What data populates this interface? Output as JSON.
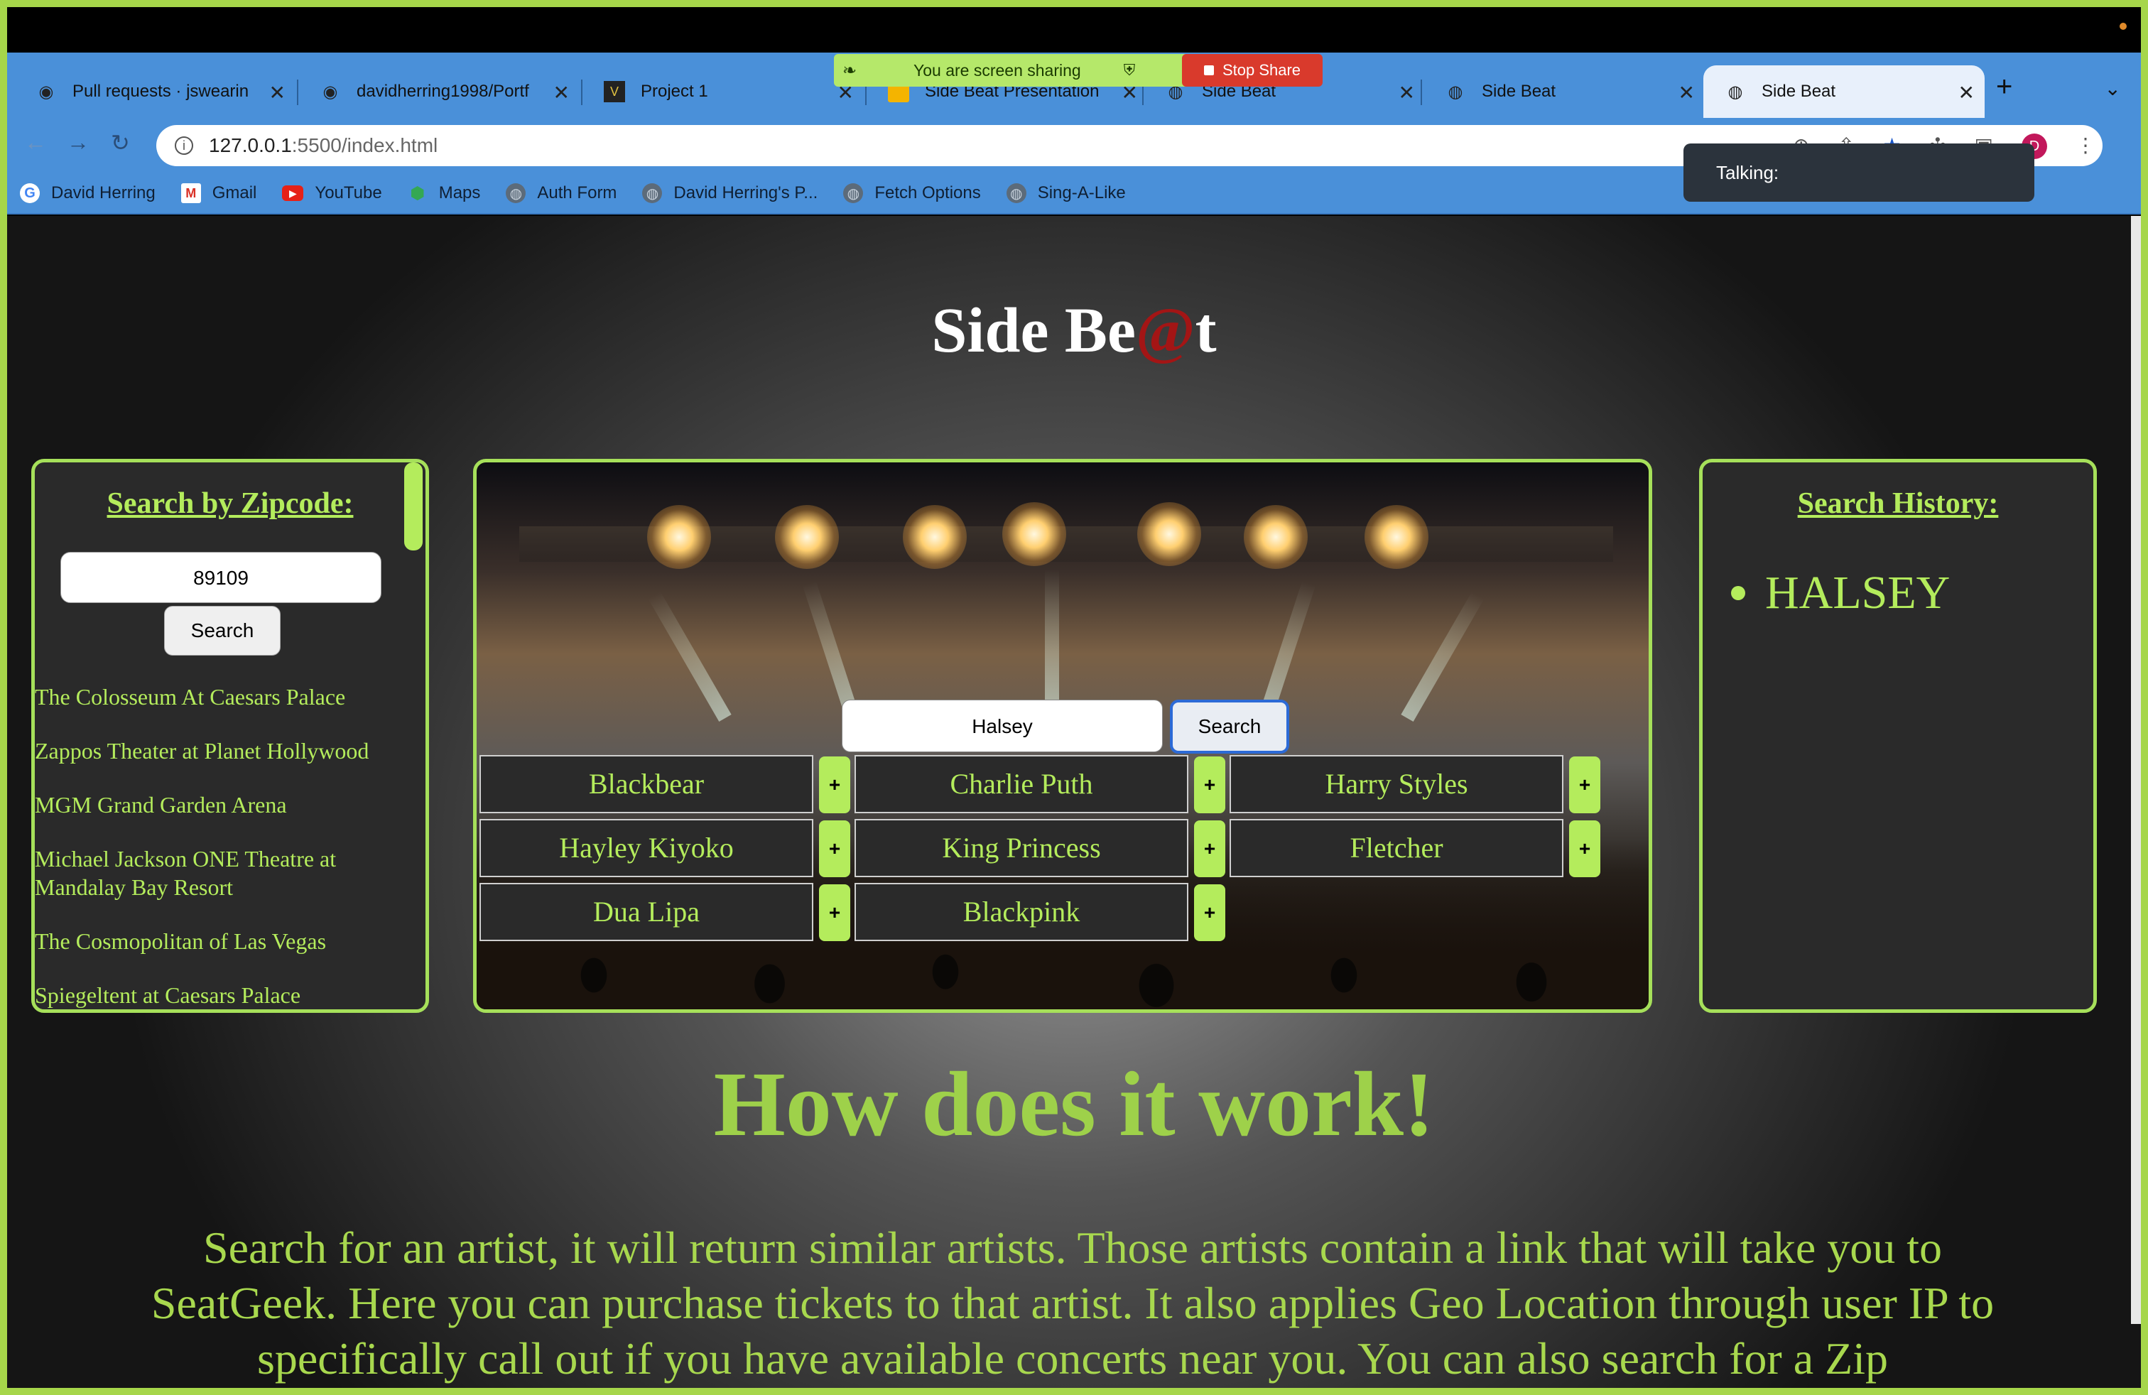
{
  "browser": {
    "tabs": [
      {
        "title": "Pull requests · jswearin",
        "icon": "github-icon"
      },
      {
        "title": "davidherring1998/Portf",
        "icon": "github-icon"
      },
      {
        "title": "Project 1",
        "icon": "project-icon"
      },
      {
        "title": "Side Beat Presentation",
        "icon": "slides-icon"
      },
      {
        "title": "Side Beat",
        "icon": "globe-icon"
      },
      {
        "title": "Side Beat",
        "icon": "globe-icon"
      },
      {
        "title": "Side Beat",
        "icon": "globe-icon",
        "active": true
      }
    ],
    "url_host": "127.0.0.1",
    "url_path": ":5500/index.html",
    "avatar_letter": "D",
    "bookmarks": [
      {
        "label": "David Herring",
        "icon": "google-icon"
      },
      {
        "label": "Gmail",
        "icon": "gmail-icon"
      },
      {
        "label": "YouTube",
        "icon": "youtube-icon"
      },
      {
        "label": "Maps",
        "icon": "maps-icon"
      },
      {
        "label": "Auth Form",
        "icon": "globe-icon"
      },
      {
        "label": "David Herring's P...",
        "icon": "globe-icon"
      },
      {
        "label": "Fetch Options",
        "icon": "globe-icon"
      },
      {
        "label": "Sing-A-Like",
        "icon": "globe-icon"
      }
    ]
  },
  "screen_share": {
    "status": "You are screen sharing",
    "stop_label": "Stop Share"
  },
  "talking_label": "Talking:",
  "site": {
    "title_prefix": "Side Be",
    "title_at": "@",
    "title_suffix": "t"
  },
  "zip_panel": {
    "heading": "Search by Zipcode:",
    "zip_value": "89109",
    "search_label": "Search",
    "venues": [
      "The Colosseum At Caesars Palace",
      "Zappos Theater at Planet Hollywood",
      "MGM Grand Garden Arena",
      "Michael Jackson ONE Theatre at Mandalay Bay Resort",
      "The Cosmopolitan of Las Vegas",
      "Spiegeltent at Caesars Palace"
    ]
  },
  "artist_search": {
    "value": "Halsey",
    "search_label": "Search",
    "add_label": "+",
    "artists": [
      "Blackbear",
      "Charlie Puth",
      "Harry Styles",
      "Hayley Kiyoko",
      "King Princess",
      "Fletcher",
      "Dua Lipa",
      "Blackpink"
    ]
  },
  "history_panel": {
    "heading": "Search History:",
    "items": [
      "HALSEY"
    ]
  },
  "how": {
    "title": "How does it work!",
    "body": "Search for an artist, it will return similar artists. Those artists contain a link that will take you to SeatGeek. Here you can purchase tickets to that artist. It also applies Geo Location through user IP to specifically call out if you have available concerts near you. You can also search for a Zip"
  },
  "colors": {
    "accent_green": "#b4ec5c",
    "brand_red": "#a31515",
    "chrome_blue": "#4a90d9",
    "stop_red": "#d93a2c"
  }
}
